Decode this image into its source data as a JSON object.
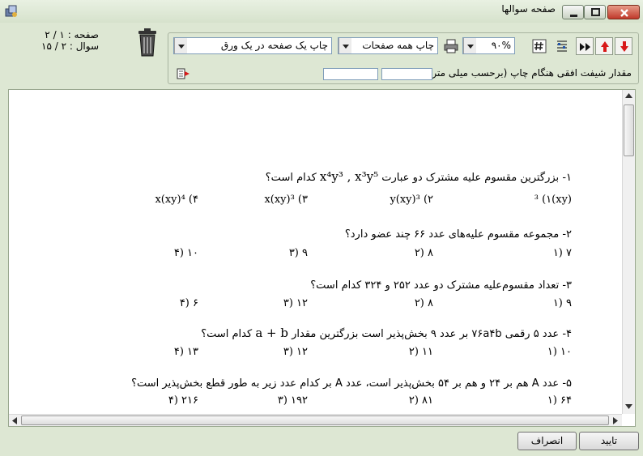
{
  "window": {
    "title": "صفحه سوالها"
  },
  "counter": {
    "page": "صفحه : ۱ / ۲",
    "question": "سوال : ۲ / ۱۵"
  },
  "toolbar": {
    "zoom": "۹۰%",
    "print_pages": "چاپ همه صفحات",
    "print_layout": "چاپ یک صفحه در یک ورق",
    "shift_label": "مقدار شیفت افقی هنگام چاپ (برحسب میلی متر) :"
  },
  "questions": [
    {
      "stem_prefix": "۱- بزرگترین مقسوم علیه مشترک دو عبارت",
      "stem_math": "x⁴y³ , x³y⁵",
      "stem_suffix": "کدام است؟",
      "options": [
        "(xy)³ (۱",
        "y(xy)³ (۲",
        "x(xy)³ (۳",
        "x(xy)⁴ (۴"
      ]
    },
    {
      "stem": "۲- مجموعه مقسوم علیه‌های عدد ۶۶ چند عضو دارد؟",
      "options": [
        "۷ (۱",
        "۸ (۲",
        "۹ (۳",
        "۱۰ (۴"
      ]
    },
    {
      "stem": "۳- تعداد مقسوم‌علیه مشترک دو عدد ۲۵۲ و ۳۲۴ کدام است؟",
      "options": [
        "۹ (۱",
        "۸ (۲",
        "۱۲ (۳",
        "۶ (۴"
      ]
    },
    {
      "stem_prefix": "۴- عدد ۵ رقمی ۷۶a۴b بر عدد ۹ بخش‌پذیر است بزرگترین مقدار",
      "stem_math": "a + b",
      "stem_suffix": "کدام است؟",
      "options": [
        "۱۰ (۱",
        "۱۱ (۲",
        "۱۲ (۳",
        "۱۳ (۴"
      ]
    },
    {
      "stem": "۵- عدد A هم بر ۲۴ و هم بر ۵۴ بخش‌پذیر است، عدد A بر کدام عدد زیر به طور قطع بخش‌پذیر است؟",
      "options": [
        "۶۴ (۱",
        "۸۱ (۲",
        "۱۹۲ (۳",
        "۲۱۶ (۴"
      ]
    }
  ],
  "buttons": {
    "confirm": "تایید",
    "cancel": "انصراف"
  }
}
